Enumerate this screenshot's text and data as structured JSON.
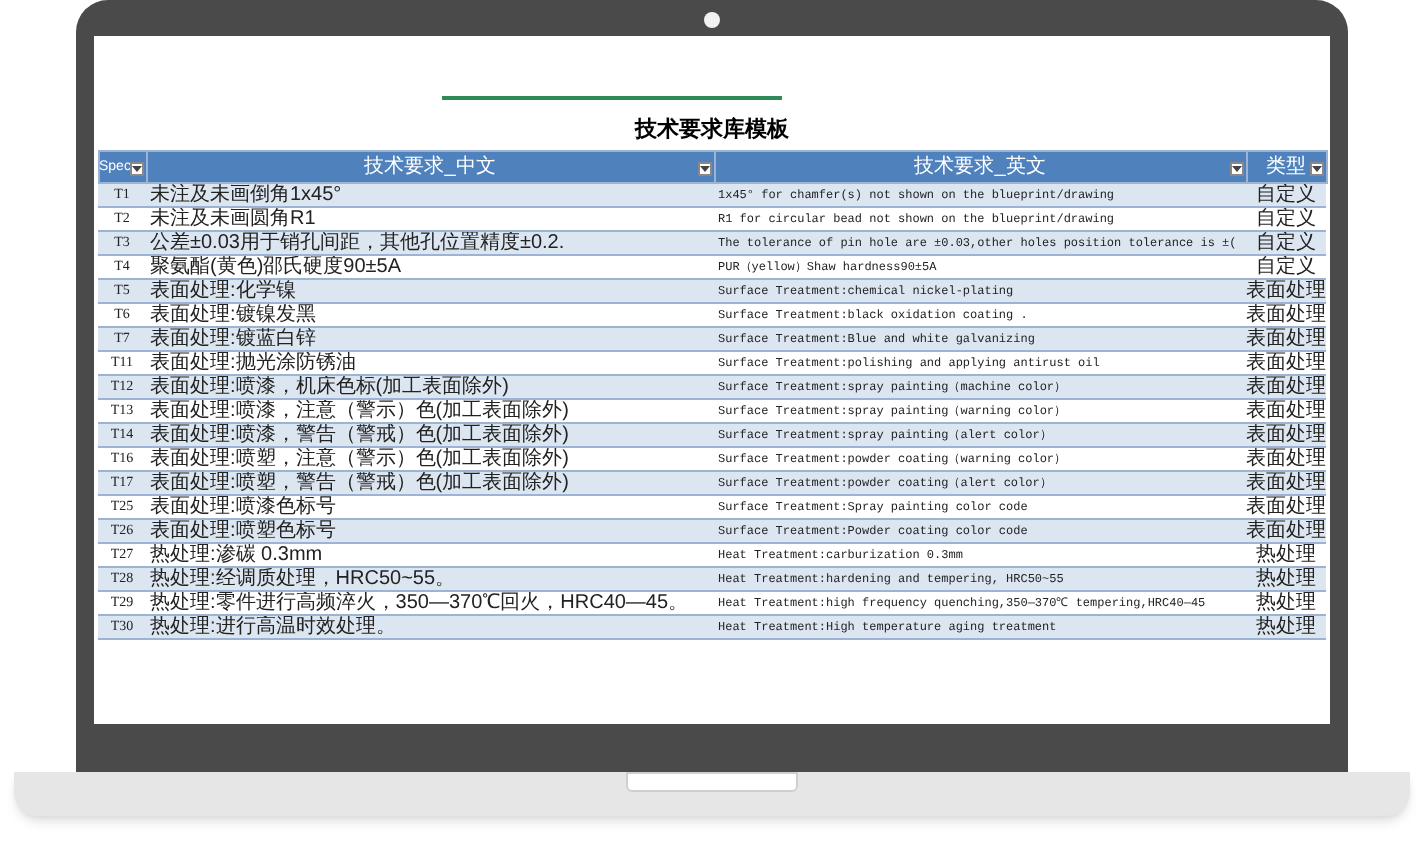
{
  "sheet": {
    "title": "技术要求库模板",
    "columns": [
      {
        "label": "Spec",
        "filter": true
      },
      {
        "label": "技术要求_中文",
        "filter": true
      },
      {
        "label": "技术要求_英文",
        "filter": true
      },
      {
        "label": "类型",
        "filter": true
      }
    ],
    "rows": [
      {
        "spec": "T1",
        "cn": "未注及未画倒角1x45°",
        "en": "1x45° for chamfer(s) not shown on the blueprint/drawing",
        "type": "自定义"
      },
      {
        "spec": "T2",
        "cn": "未注及未画圆角R1",
        "en": "R1 for circular bead not shown on the blueprint/drawing",
        "type": "自定义"
      },
      {
        "spec": "T3",
        "cn": "公差±0.03用于销孔间距，其他孔位置精度±0.2.",
        "en": "The tolerance of pin hole are ±0.03,other holes position tolerance is ±(",
        "type": "自定义"
      },
      {
        "spec": "T4",
        "cn": "聚氨酯(黄色)邵氏硬度90±5A",
        "en": "PUR（yellow）Shaw hardness90±5A",
        "type": "自定义"
      },
      {
        "spec": "T5",
        "cn": "表面处理:化学镍",
        "en": "Surface Treatment:chemical nickel-plating",
        "type": "表面处理"
      },
      {
        "spec": "T6",
        "cn": "表面处理:镀镍发黑",
        "en": "Surface Treatment:black oxidation coating .",
        "type": "表面处理"
      },
      {
        "spec": "T7",
        "cn": "表面处理:镀蓝白锌",
        "en": "Surface Treatment:Blue and white galvanizing",
        "type": "表面处理"
      },
      {
        "spec": "T11",
        "cn": "表面处理:抛光涂防锈油",
        "en": "Surface Treatment:polishing and applying antirust oil",
        "type": "表面处理"
      },
      {
        "spec": "T12",
        "cn": "表面处理:喷漆，机床色标(加工表面除外)",
        "en": "Surface Treatment:spray painting（machine color）",
        "type": "表面处理"
      },
      {
        "spec": "T13",
        "cn": "表面处理:喷漆，注意（警示）色(加工表面除外)",
        "en": "Surface Treatment:spray painting（warning color）",
        "type": "表面处理"
      },
      {
        "spec": "T14",
        "cn": "表面处理:喷漆，警告（警戒）色(加工表面除外)",
        "en": "Surface Treatment:spray painting（alert color）",
        "type": "表面处理"
      },
      {
        "spec": "T16",
        "cn": "表面处理:喷塑，注意（警示）色(加工表面除外)",
        "en": "Surface Treatment:powder coating（warning color）",
        "type": "表面处理"
      },
      {
        "spec": "T17",
        "cn": "表面处理:喷塑，警告（警戒）色(加工表面除外)",
        "en": "Surface Treatment:powder coating（alert color）",
        "type": "表面处理"
      },
      {
        "spec": "T25",
        "cn": "表面处理:喷漆色标号",
        "en": "Surface Treatment:Spray painting color code",
        "type": "表面处理"
      },
      {
        "spec": "T26",
        "cn": "表面处理:喷塑色标号",
        "en": "Surface Treatment:Powder coating color code",
        "type": "表面处理"
      },
      {
        "spec": "T27",
        "cn": "热处理:渗碳 0.3mm",
        "en": "Heat Treatment:carburization 0.3mm",
        "type": "热处理"
      },
      {
        "spec": "T28",
        "cn": "热处理:经调质处理，HRC50~55。",
        "en": "Heat Treatment:hardening and tempering, HRC50~55",
        "type": "热处理"
      },
      {
        "spec": "T29",
        "cn": "热处理:零件进行高频淬火，350—370℃回火，HRC40—45。",
        "en": "Heat Treatment:high frequency quenching,350—370℃ tempering,HRC40—45",
        "type": "热处理"
      },
      {
        "spec": "T30",
        "cn": "热处理:进行高温时效处理。",
        "en": "Heat Treatment:High temperature aging treatment",
        "type": "热处理"
      }
    ]
  }
}
